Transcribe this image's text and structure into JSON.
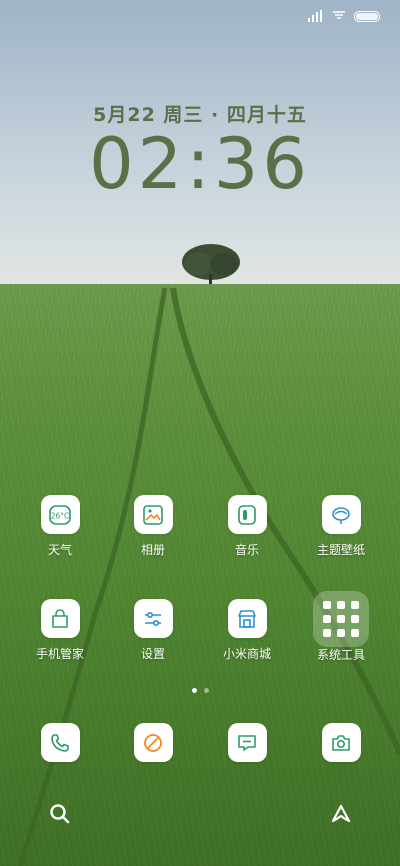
{
  "status_bar": {
    "signal_icon": "signal-bars-icon",
    "wifi_icon": "wifi-icon",
    "battery_icon": "battery-icon"
  },
  "clock": {
    "date": "5月22 周三 · 四月十五",
    "time": "02:36"
  },
  "apps": [
    {
      "label": "天气",
      "icon": "weather-icon",
      "icon_text": "26°C"
    },
    {
      "label": "相册",
      "icon": "gallery-icon"
    },
    {
      "label": "音乐",
      "icon": "music-icon"
    },
    {
      "label": "主题壁纸",
      "icon": "themes-icon"
    },
    {
      "label": "手机管家",
      "icon": "security-icon"
    },
    {
      "label": "设置",
      "icon": "settings-icon"
    },
    {
      "label": "小米商城",
      "icon": "mi-store-icon"
    },
    {
      "label": "系统工具",
      "icon": "folder-icon"
    }
  ],
  "pager": {
    "pages": 2,
    "current": 1
  },
  "dock": [
    {
      "icon": "phone-icon"
    },
    {
      "icon": "browser-icon"
    },
    {
      "icon": "messages-icon"
    },
    {
      "icon": "camera-icon"
    }
  ],
  "bottom": {
    "left_icon": "search-icon",
    "right_icon": "app-vault-icon"
  },
  "colors": {
    "clock": "#5a7048",
    "icon_tile": "#ffffff",
    "icon_accent_green": "#2e9a68",
    "icon_accent_orange": "#f08a24",
    "icon_accent_blue": "#2f8fd0"
  }
}
